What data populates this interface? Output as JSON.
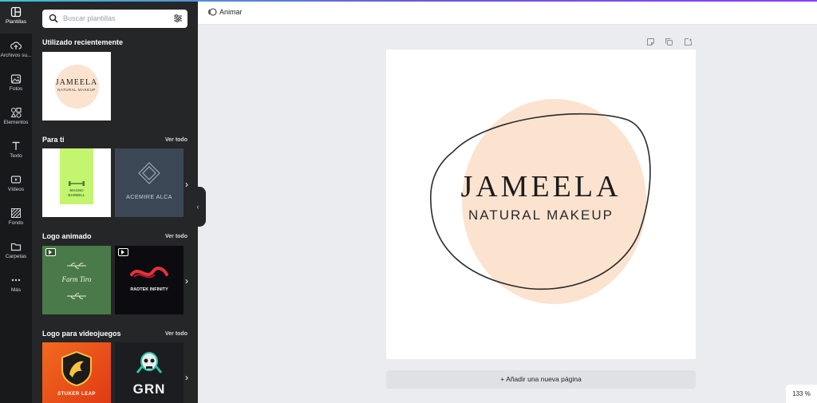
{
  "rail": {
    "items": [
      {
        "label": "Plantillas",
        "icon": "templates-icon"
      },
      {
        "label": "Archivos su...",
        "icon": "upload-cloud-icon"
      },
      {
        "label": "Fotos",
        "icon": "photos-icon"
      },
      {
        "label": "Elementos",
        "icon": "elements-icon"
      },
      {
        "label": "Texto",
        "icon": "text-icon"
      },
      {
        "label": "Vídeos",
        "icon": "video-icon"
      },
      {
        "label": "Fondo",
        "icon": "background-icon"
      },
      {
        "label": "Carpetas",
        "icon": "folder-icon"
      },
      {
        "label": "Más",
        "icon": "more-icon"
      }
    ]
  },
  "panel": {
    "search_placeholder": "Buscar plantillas",
    "sections": [
      {
        "title": "Utilizado recientemente",
        "see_all": ""
      },
      {
        "title": "Para ti",
        "see_all": "Ver todo"
      },
      {
        "title": "Logo animado",
        "see_all": "Ver todo"
      },
      {
        "title": "Logo para videojuegos",
        "see_all": "Ver todo"
      }
    ],
    "thumbs": {
      "recent": {
        "name": "JAMEELA",
        "sub": "NATURAL MAKEUP"
      },
      "parati_1": {
        "name": "MAGNO",
        "sub": "BARBELL"
      },
      "parati_2": {
        "name": "ACEMIRE ALCA"
      },
      "animado_1": {
        "name": "Farm Tiro"
      },
      "animado_2": {
        "name": "RADTEK INFINITY"
      },
      "juegos_1": {
        "name": "STUKER LEAP"
      },
      "juegos_2": {
        "name": "GRN"
      }
    }
  },
  "topbar": {
    "animate_label": "Animar"
  },
  "canvas": {
    "logo_name": "JAMEELA",
    "logo_sub": "NATURAL MAKEUP"
  },
  "footer": {
    "add_page_label": "+ Añadir una nueva página",
    "zoom": "133 %"
  },
  "colors": {
    "rail_bg": "#18191b",
    "panel_bg": "#252627",
    "peach": "#fbe3d0",
    "workspace": "#ebecf0"
  }
}
